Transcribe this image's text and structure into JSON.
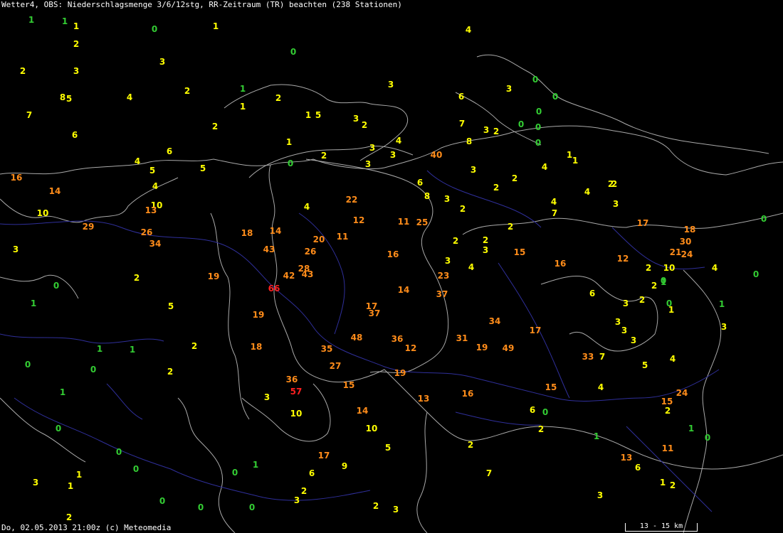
{
  "title": "Wetter4, OBS: Niederschlagsmenge 3/6/12stg, RR-Zeitraum (TR) beachten (238 Stationen)",
  "footer": "Do, 02.05.2013 21:00z (c) Meteomedia",
  "scale_label": "13 - 15 km",
  "colors": {
    "background": "#000000",
    "border": "#a9a9a9",
    "river": "#2f2f9a",
    "class_0": "#33cc33",
    "class_1": "#ffff00",
    "class_2": "#ff8c1a",
    "class_3": "#ff2020"
  },
  "stations": [
    {
      "v": "1",
      "c": 1
    },
    {
      "v": "1",
      "c": 1
    },
    {
      "v": "1",
      "c": 2
    },
    {
      "v": "0",
      "c": 1
    },
    {
      "v": "1",
      "c": 2
    },
    {
      "v": "4",
      "c": 2
    },
    {
      "v": "2",
      "c": 2
    },
    {
      "v": "0",
      "c": 1
    },
    {
      "v": "2",
      "c": 2
    },
    {
      "v": "3",
      "c": 2
    },
    {
      "v": "3",
      "c": 2
    },
    {
      "v": "0",
      "c": 1
    },
    {
      "v": "2",
      "c": 2
    },
    {
      "v": "1",
      "c": 1
    },
    {
      "v": "2",
      "c": 2
    },
    {
      "v": "3",
      "c": 2
    },
    {
      "v": "6",
      "c": 2
    },
    {
      "v": "3",
      "c": 2
    },
    {
      "v": "8",
      "c": 2
    },
    {
      "v": "5",
      "c": 2
    },
    {
      "v": "4",
      "c": 2
    },
    {
      "v": "0",
      "c": 1
    },
    {
      "v": "0",
      "c": 1
    },
    {
      "v": "7",
      "c": 2
    },
    {
      "v": "1",
      "c": 2
    },
    {
      "v": "1",
      "c": 2
    },
    {
      "v": "5",
      "c": 2
    },
    {
      "v": "3",
      "c": 2
    },
    {
      "v": "0",
      "c": 1
    },
    {
      "v": "2",
      "c": 2
    },
    {
      "v": "2",
      "c": 2
    },
    {
      "v": "7",
      "c": 2
    },
    {
      "v": "3",
      "c": 2
    },
    {
      "v": "2",
      "c": 2
    },
    {
      "v": "0",
      "c": 1
    },
    {
      "v": "0",
      "c": 1
    },
    {
      "v": "6",
      "c": 2
    },
    {
      "v": "4",
      "c": 2
    },
    {
      "v": "8",
      "c": 2
    },
    {
      "v": "1",
      "c": 2
    },
    {
      "v": "1",
      "c": 2
    },
    {
      "v": "0",
      "c": 1
    },
    {
      "v": "6",
      "c": 2
    },
    {
      "v": "1",
      "c": 2
    },
    {
      "v": "3",
      "c": 2
    },
    {
      "v": "3",
      "c": 2
    },
    {
      "v": "2",
      "c": 2
    },
    {
      "v": "40",
      "c": 3
    },
    {
      "v": "4",
      "c": 2
    },
    {
      "v": "5",
      "c": 2
    },
    {
      "v": "5",
      "c": 2
    },
    {
      "v": "3",
      "c": 2
    },
    {
      "v": "4",
      "c": 2
    },
    {
      "v": "16",
      "c": 3
    },
    {
      "v": "2",
      "c": 2
    },
    {
      "v": "3",
      "c": 2
    },
    {
      "v": "2",
      "c": 2
    },
    {
      "v": "14",
      "c": 3
    },
    {
      "v": "4",
      "c": 2
    },
    {
      "v": "6",
      "c": 2
    },
    {
      "v": "4",
      "c": 2
    },
    {
      "v": "2",
      "c": 2
    },
    {
      "v": "8",
      "c": 2
    },
    {
      "v": "3",
      "c": 2
    },
    {
      "v": "22",
      "c": 3
    },
    {
      "v": "10",
      "c": 2
    },
    {
      "v": "13",
      "c": 3
    },
    {
      "v": "4",
      "c": 2
    },
    {
      "v": "2",
      "c": 2
    },
    {
      "v": "2",
      "c": 2
    },
    {
      "v": "4",
      "c": 2
    },
    {
      "v": "7",
      "c": 2
    },
    {
      "v": "3",
      "c": 2
    },
    {
      "v": "10",
      "c": 2
    },
    {
      "v": "29",
      "c": 3
    },
    {
      "v": "12",
      "c": 3
    },
    {
      "v": "11",
      "c": 3
    },
    {
      "v": "25",
      "c": 3
    },
    {
      "v": "2",
      "c": 2
    },
    {
      "v": "17",
      "c": 3
    },
    {
      "v": "18",
      "c": 3
    },
    {
      "v": "0",
      "c": 1
    },
    {
      "v": "26",
      "c": 3
    },
    {
      "v": "18",
      "c": 3
    },
    {
      "v": "14",
      "c": 3
    },
    {
      "v": "20",
      "c": 3
    },
    {
      "v": "11",
      "c": 3
    },
    {
      "v": "2",
      "c": 2
    },
    {
      "v": "2",
      "c": 2
    },
    {
      "v": "30",
      "c": 3
    },
    {
      "v": "34",
      "c": 3
    },
    {
      "v": "43",
      "c": 3
    },
    {
      "v": "26",
      "c": 3
    },
    {
      "v": "16",
      "c": 3
    },
    {
      "v": "15",
      "c": 3
    },
    {
      "v": "12",
      "c": 3
    },
    {
      "v": "21",
      "c": 3
    },
    {
      "v": "24",
      "c": 3
    },
    {
      "v": "3",
      "c": 2
    },
    {
      "v": "3",
      "c": 2
    },
    {
      "v": "28",
      "c": 3
    },
    {
      "v": "3",
      "c": 2
    },
    {
      "v": "4",
      "c": 2
    },
    {
      "v": "16",
      "c": 3
    },
    {
      "v": "2",
      "c": 2
    },
    {
      "v": "10",
      "c": 2
    },
    {
      "v": "4",
      "c": 2
    },
    {
      "v": "19",
      "c": 3
    },
    {
      "v": "42",
      "c": 3
    },
    {
      "v": "43",
      "c": 3
    },
    {
      "v": "23",
      "c": 3
    },
    {
      "v": "2",
      "c": 2
    },
    {
      "v": "0",
      "c": 1
    },
    {
      "v": "0",
      "c": 1
    },
    {
      "v": "0",
      "c": 1
    },
    {
      "v": "66",
      "c": 4
    },
    {
      "v": "14",
      "c": 3
    },
    {
      "v": "2",
      "c": 2
    },
    {
      "v": "1",
      "c": 1
    },
    {
      "v": "1",
      "c": 1
    },
    {
      "v": "37",
      "c": 3
    },
    {
      "v": "6",
      "c": 2
    },
    {
      "v": "5",
      "c": 2
    },
    {
      "v": "17",
      "c": 3
    },
    {
      "v": "19",
      "c": 3
    },
    {
      "v": "37",
      "c": 3
    },
    {
      "v": "3",
      "c": 2
    },
    {
      "v": "2",
      "c": 2
    },
    {
      "v": "0",
      "c": 1
    },
    {
      "v": "1",
      "c": 2
    },
    {
      "v": "1",
      "c": 1
    },
    {
      "v": "34",
      "c": 3
    },
    {
      "v": "3",
      "c": 2
    },
    {
      "v": "3",
      "c": 2
    },
    {
      "v": "3",
      "c": 2
    },
    {
      "v": "17",
      "c": 3
    },
    {
      "v": "48",
      "c": 3
    },
    {
      "v": "36",
      "c": 3
    },
    {
      "v": "31",
      "c": 3
    },
    {
      "v": "3",
      "c": 2
    },
    {
      "v": "2",
      "c": 2
    },
    {
      "v": "18",
      "c": 3
    },
    {
      "v": "35",
      "c": 3
    },
    {
      "v": "12",
      "c": 3
    },
    {
      "v": "19",
      "c": 3
    },
    {
      "v": "49",
      "c": 3
    },
    {
      "v": "1",
      "c": 1
    },
    {
      "v": "1",
      "c": 1
    },
    {
      "v": "0",
      "c": 1
    },
    {
      "v": "33",
      "c": 3
    },
    {
      "v": "7",
      "c": 2
    },
    {
      "v": "0",
      "c": 1
    },
    {
      "v": "2",
      "c": 2
    },
    {
      "v": "27",
      "c": 3
    },
    {
      "v": "19",
      "c": 3
    },
    {
      "v": "4",
      "c": 2
    },
    {
      "v": "5",
      "c": 2
    },
    {
      "v": "36",
      "c": 3
    },
    {
      "v": "15",
      "c": 3
    },
    {
      "v": "1",
      "c": 1
    },
    {
      "v": "15",
      "c": 3
    },
    {
      "v": "4",
      "c": 2
    },
    {
      "v": "3",
      "c": 2
    },
    {
      "v": "57",
      "c": 4
    },
    {
      "v": "13",
      "c": 3
    },
    {
      "v": "16",
      "c": 3
    },
    {
      "v": "24",
      "c": 3
    },
    {
      "v": "15",
      "c": 3
    },
    {
      "v": "0",
      "c": 1
    },
    {
      "v": "14",
      "c": 3
    },
    {
      "v": "6",
      "c": 2
    },
    {
      "v": "0",
      "c": 1
    },
    {
      "v": "2",
      "c": 2
    },
    {
      "v": "10",
      "c": 2
    },
    {
      "v": "10",
      "c": 2
    },
    {
      "v": "2",
      "c": 2
    },
    {
      "v": "1",
      "c": 1
    },
    {
      "v": "0",
      "c": 1
    },
    {
      "v": "1",
      "c": 1
    },
    {
      "v": "5",
      "c": 2
    },
    {
      "v": "2",
      "c": 2
    },
    {
      "v": "11",
      "c": 3
    },
    {
      "v": "0",
      "c": 1
    },
    {
      "v": "17",
      "c": 3
    },
    {
      "v": "13",
      "c": 3
    },
    {
      "v": "1",
      "c": 2
    },
    {
      "v": "0",
      "c": 1
    },
    {
      "v": "1",
      "c": 1
    },
    {
      "v": "6",
      "c": 2
    },
    {
      "v": "9",
      "c": 2
    },
    {
      "v": "6",
      "c": 2
    },
    {
      "v": "7",
      "c": 2
    },
    {
      "v": "0",
      "c": 1
    },
    {
      "v": "3",
      "c": 2
    },
    {
      "v": "1",
      "c": 2
    },
    {
      "v": "2",
      "c": 2
    },
    {
      "v": "1",
      "c": 2
    },
    {
      "v": "2",
      "c": 2
    },
    {
      "v": "3",
      "c": 2
    },
    {
      "v": "0",
      "c": 1
    },
    {
      "v": "0",
      "c": 1
    },
    {
      "v": "0",
      "c": 1
    },
    {
      "v": "3",
      "c": 2
    },
    {
      "v": "2",
      "c": 2
    },
    {
      "v": "3",
      "c": 2
    },
    {
      "v": "2",
      "c": 2
    }
  ]
}
